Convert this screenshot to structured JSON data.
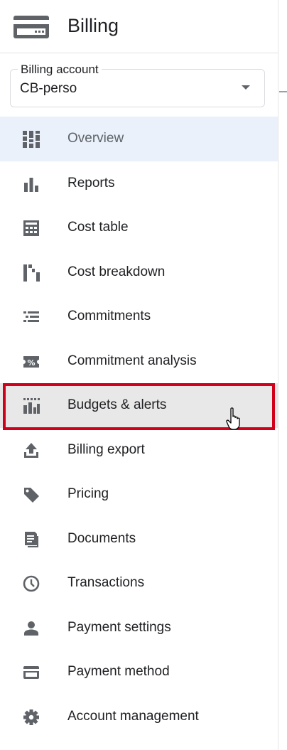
{
  "header": {
    "title": "Billing",
    "icon": "billing-card-icon"
  },
  "billing_account": {
    "label": "Billing account",
    "value": "CB-perso"
  },
  "nav": {
    "selected": "Overview",
    "hovered": "Budgets & alerts",
    "items": [
      {
        "label": "Overview",
        "icon": "overview-icon"
      },
      {
        "label": "Reports",
        "icon": "bar-chart-icon"
      },
      {
        "label": "Cost table",
        "icon": "table-icon"
      },
      {
        "label": "Cost breakdown",
        "icon": "waterfall-chart-icon"
      },
      {
        "label": "Commitments",
        "icon": "list-icon"
      },
      {
        "label": "Commitment analysis",
        "icon": "percent-ticket-icon"
      },
      {
        "label": "Budgets & alerts",
        "icon": "budget-chart-icon"
      },
      {
        "label": "Billing export",
        "icon": "upload-icon"
      },
      {
        "label": "Pricing",
        "icon": "price-tag-icon"
      },
      {
        "label": "Documents",
        "icon": "document-icon"
      },
      {
        "label": "Transactions",
        "icon": "clock-icon"
      },
      {
        "label": "Payment settings",
        "icon": "person-icon"
      },
      {
        "label": "Payment method",
        "icon": "credit-card-icon"
      },
      {
        "label": "Account management",
        "icon": "gear-icon"
      }
    ]
  },
  "colors": {
    "accent_highlight": "#d0021b",
    "selected_background": "#eaf1fb",
    "hover_background": "#e8e8e8",
    "icon": "#5f6368"
  }
}
